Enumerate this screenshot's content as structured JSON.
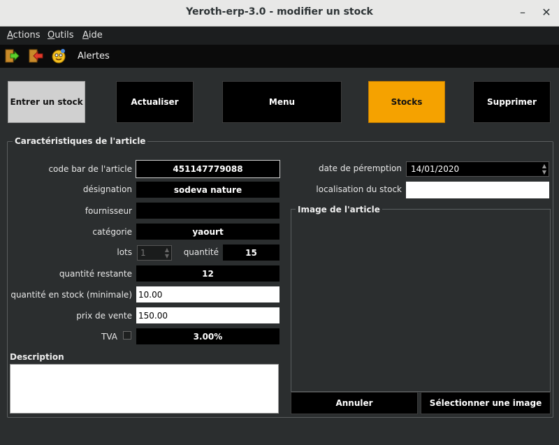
{
  "window": {
    "title": "Yeroth-erp-3.0 - modifier un stock",
    "minimize": "–",
    "close": "✕"
  },
  "menu": {
    "actions": "Actions",
    "outils": "Outils",
    "aide": "Aide"
  },
  "toolbar": {
    "alertes": "Alertes"
  },
  "buttons": {
    "entrer": "Entrer un stock",
    "actualiser": "Actualiser",
    "menu": "Menu",
    "stocks": "Stocks",
    "supprimer": "Supprimer",
    "annuler": "Annuler",
    "selectionner_image": "Sélectionner une image"
  },
  "colors": {
    "stocks_active": "#f5a200",
    "entrer_bg": "#d0d0d0"
  },
  "group": {
    "title": "Caractéristiques de l'article"
  },
  "form": {
    "code_barre_label": "code bar de l'article",
    "code_barre": "451147779088",
    "designation_label": "désignation",
    "designation": "sodeva nature",
    "fournisseur_label": "fournisseur",
    "fournisseur": "",
    "categorie_label": "catégorie",
    "categorie": "yaourt",
    "lots_label": "lots",
    "lots": "1",
    "quantite_label": "quantité",
    "quantite": "15",
    "quantite_restante_label": "quantité restante",
    "quantite_restante": "12",
    "qte_min_label": "quantité en stock (minimale)",
    "qte_min": "10.00",
    "prix_label": "prix de vente",
    "prix": "150.00",
    "tva_label": "TVA",
    "tva": "3.00%",
    "description_label": "Description",
    "peremption_label": "date de péremption",
    "peremption": "14/01/2020",
    "localisation_label": "localisation du stock",
    "localisation": ""
  },
  "image": {
    "title": "Image de l'article"
  }
}
